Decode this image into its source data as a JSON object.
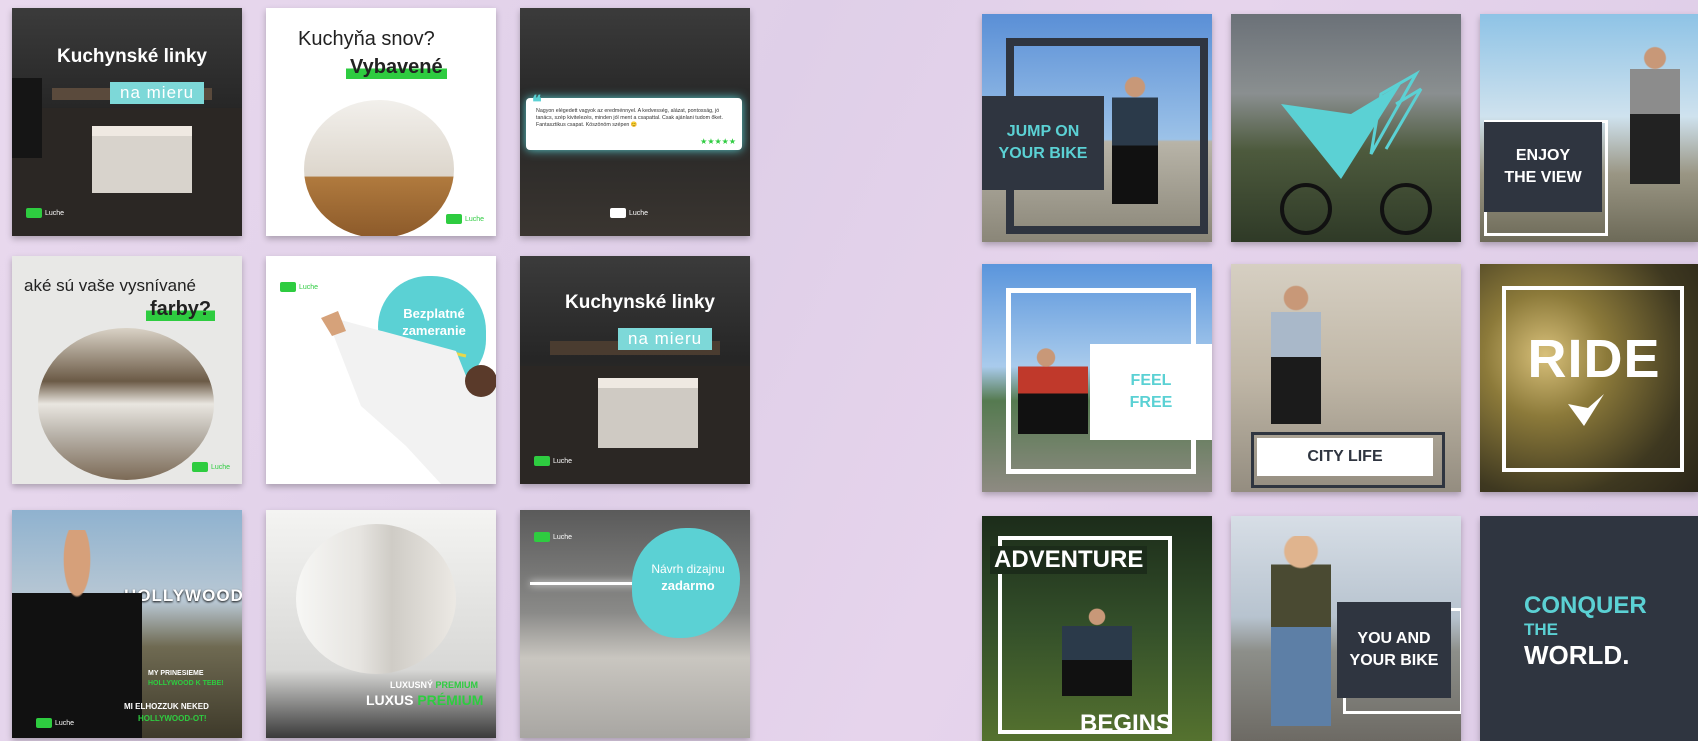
{
  "left_grid": {
    "t1": {
      "title": "Kuchynské linky",
      "pill": "na mieru",
      "logo": "Luche"
    },
    "t2": {
      "line1": "Kuchyňa snov?",
      "line2": "Vybavené",
      "logo": "Luche"
    },
    "t3": {
      "review": "Nagyon elégedett vagyok az eredménnyel. A kedvesség, alázat, pontosság, jó tanács, szép kivitelezés, minden jól ment a csapattal. Csak ajánlani tudom őket. Fantasztikus csapat. Köszönöm szépen 😊",
      "logo": "Luche"
    },
    "t4": {
      "line1": "aké sú vaše vysnívané",
      "line2": "farby?",
      "logo": "Luche"
    },
    "t5": {
      "blob": "Bezplatné zameranie",
      "logo": "Luche"
    },
    "t6": {
      "title": "Kuchynské linky",
      "pill": "na mieru",
      "logo": "Luche"
    },
    "t7": {
      "sign": "HOLLYWOOD",
      "l1": "MY PRINESIEME",
      "l2": "HOLLYWOOD K TEBE!",
      "l3": "MI ELHOZZUK NEKED",
      "l4": "HOLLYWOOD-OT!",
      "logo": "Luche"
    },
    "t8": {
      "l1": "LUXUSNÝ",
      "l1b": "PREMIUM",
      "l2": "LUXUS",
      "l2b": "PRÉMIUM"
    },
    "t9": {
      "blob1": "Návrh dizajnu",
      "blob2": "zadarmo",
      "logo": "Luche"
    }
  },
  "right_grid": {
    "b1": "JUMP ON YOUR BIKE",
    "b3": "ENJOY THE VIEW",
    "b4": "FEEL FREE",
    "b5": "CITY LIFE",
    "b6": "RIDE",
    "b7a": "ADVENTURE",
    "b7b": "BEGINS",
    "b8": "YOU AND YOUR BIKE",
    "b9a": "CONQUER",
    "b9b": "THE",
    "b9c": "WORLD."
  },
  "colors": {
    "teal": "#5bd1d4",
    "green": "#2ecc40",
    "navy": "#2f3540"
  }
}
